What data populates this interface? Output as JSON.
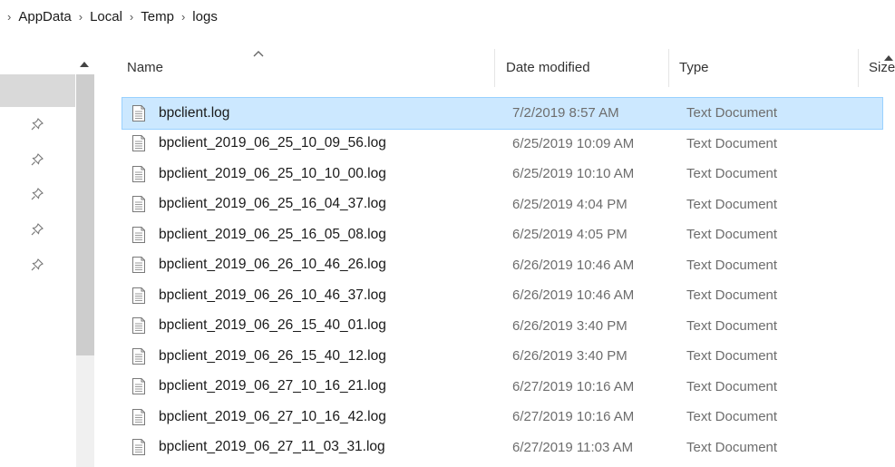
{
  "breadcrumb": {
    "items": [
      "AppData",
      "Local",
      "Temp",
      "logs"
    ]
  },
  "header": {
    "name": "Name",
    "date_modified": "Date modified",
    "type": "Type",
    "size": "Size"
  },
  "files": [
    {
      "name": "bpclient.log",
      "date": "7/2/2019 8:57 AM",
      "type": "Text Document",
      "selected": true
    },
    {
      "name": "bpclient_2019_06_25_10_09_56.log",
      "date": "6/25/2019 10:09 AM",
      "type": "Text Document"
    },
    {
      "name": "bpclient_2019_06_25_10_10_00.log",
      "date": "6/25/2019 10:10 AM",
      "type": "Text Document"
    },
    {
      "name": "bpclient_2019_06_25_16_04_37.log",
      "date": "6/25/2019 4:04 PM",
      "type": "Text Document"
    },
    {
      "name": "bpclient_2019_06_25_16_05_08.log",
      "date": "6/25/2019 4:05 PM",
      "type": "Text Document"
    },
    {
      "name": "bpclient_2019_06_26_10_46_26.log",
      "date": "6/26/2019 10:46 AM",
      "type": "Text Document"
    },
    {
      "name": "bpclient_2019_06_26_10_46_37.log",
      "date": "6/26/2019 10:46 AM",
      "type": "Text Document"
    },
    {
      "name": "bpclient_2019_06_26_15_40_01.log",
      "date": "6/26/2019 3:40 PM",
      "type": "Text Document"
    },
    {
      "name": "bpclient_2019_06_26_15_40_12.log",
      "date": "6/26/2019 3:40 PM",
      "type": "Text Document"
    },
    {
      "name": "bpclient_2019_06_27_10_16_21.log",
      "date": "6/27/2019 10:16 AM",
      "type": "Text Document"
    },
    {
      "name": "bpclient_2019_06_27_10_16_42.log",
      "date": "6/27/2019 10:16 AM",
      "type": "Text Document"
    },
    {
      "name": "bpclient_2019_06_27_11_03_31.log",
      "date": "6/27/2019 11:03 AM",
      "type": "Text Document"
    }
  ],
  "nav": {
    "pins": 5
  },
  "colors": {
    "selected_row": "#cce8ff",
    "selected_border": "#99d1ff"
  }
}
